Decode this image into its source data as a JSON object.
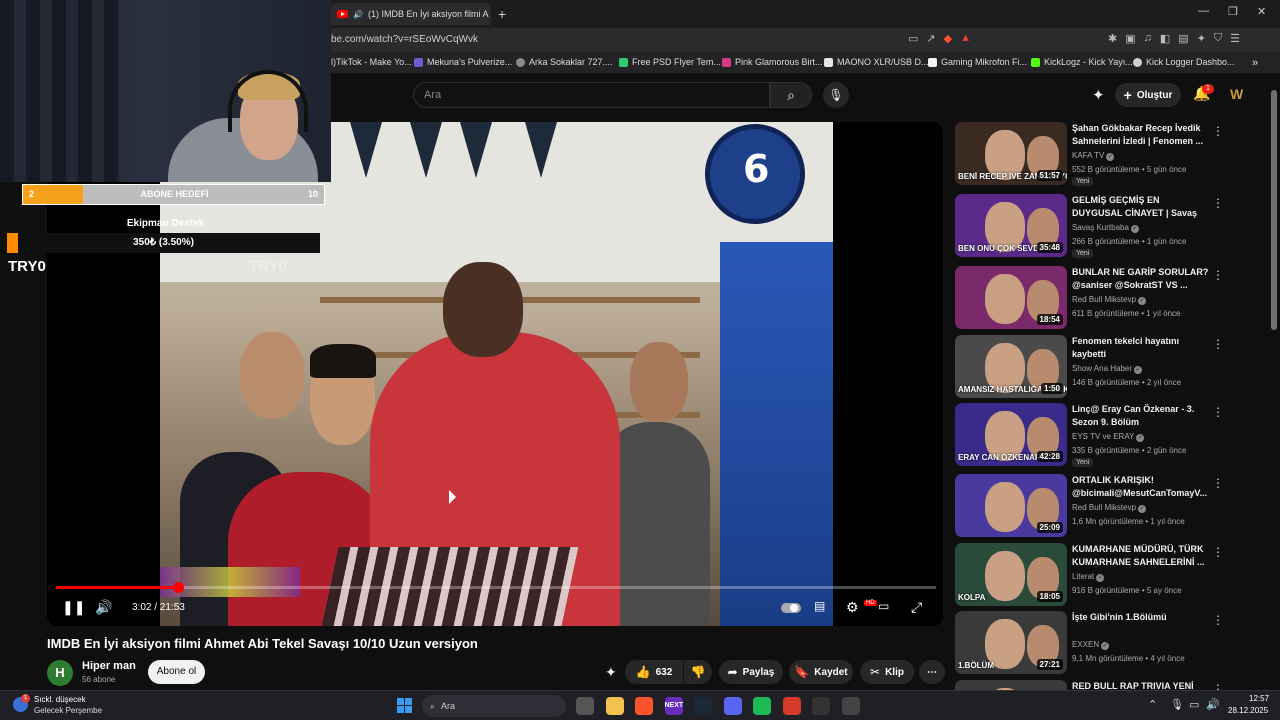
{
  "browser": {
    "tab_title": "(1) IMDB En İyi aksiyon filmi A",
    "tab_close": "✕",
    "new_tab": "+",
    "url": "be.com/watch?v=rSEoWvCqWvk",
    "window_controls": [
      "—",
      "❐",
      "✕"
    ],
    "bookmarks": [
      {
        "label": "l)TikTok - Make Yo...",
        "color": "#000000"
      },
      {
        "label": "Mekuna's Pulverize...",
        "color": "#6d5bd0"
      },
      {
        "label": "Arka Sokaklar 727....",
        "color": "#8a8a8a"
      },
      {
        "label": "Free PSD Flyer Tem...",
        "color": "#2ecc71"
      },
      {
        "label": "Pink Glamorous Birt...",
        "color": "#d83a8a"
      },
      {
        "label": "MAONO XLR/USB D...",
        "color": "#e6e6e6"
      },
      {
        "label": "Gaming Mikrofon Fi...",
        "color": "#f3f3f3"
      },
      {
        "label": "KickLogz - Kick Yayı...",
        "color": "#53fc18"
      },
      {
        "label": "Kick Logger Dashbo...",
        "color": "#cfcfcf"
      }
    ]
  },
  "header": {
    "search_placeholder": "Ara",
    "create_label": "Oluştur",
    "notification_count": "1"
  },
  "overlay": {
    "goal_current": "2",
    "goal_label": "ABONE HEDEFİ",
    "goal_target": "10",
    "goal_fraction": 0.2,
    "equipment_title": "Ekipman Destek",
    "equipment_amount": "350₺ (3.50%)",
    "equipment_fraction": 0.035,
    "streamer_name": "TRY0",
    "watermark": "TRY0"
  },
  "player": {
    "clock_numeral": "6",
    "time_display": "3:02 / 21:53",
    "progress_fraction": 0.1386,
    "hd_label": "HD"
  },
  "video": {
    "title": "IMDB En İyi aksiyon filmi Ahmet Abi Tekel Savaşı 10/10 Uzun versiyon",
    "channel_initial": "H",
    "channel_name": "Hiper man",
    "subscribers": "56 abone",
    "subscribe_label": "Abone ol",
    "like_count": "632",
    "share_label": "Paylaş",
    "save_label": "Kaydet",
    "clip_label": "Klip",
    "more_label": "⋯"
  },
  "recommendations": [
    {
      "title": "Şahan Gökbakar Recep İvedik Sahnelerini İzledi | Fenomen ...",
      "channel": "KAFA TV",
      "meta": "552 B görüntüleme • 5 gün önce",
      "duration": "51:57",
      "badge": "Yeni",
      "caption": "BENİ RECEP İVE ZANNEDİYORL",
      "bg": "#3a2a22"
    },
    {
      "title": "GELMİŞ GEÇMİŞ EN DUYGUSAL CİNAYET | Savaş Kurtbaba ile ...",
      "channel": "Savaş Kurtbaba",
      "meta": "266 B görüntüleme • 1 gün önce",
      "duration": "35:48",
      "badge": "Yeni",
      "caption": "BEN ONU ÇOK SEVDİ",
      "bg": "#5a2a8a"
    },
    {
      "title": "BUNLAR NE GARİP SORULAR? @saniser @SokratST VS ...",
      "channel": "Red Bull Mikstevp",
      "meta": "611 B görüntüleme • 1 yıl önce",
      "duration": "18:54",
      "badge": "",
      "caption": "",
      "bg": "#7a2a6a"
    },
    {
      "title": "Fenomen tekelci hayatını kaybetti",
      "channel": "Show Ana Haber",
      "meta": "146 B görüntüleme • 2 yıl önce",
      "duration": "1:50",
      "badge": "",
      "caption": "AMANSIZ HASTALIĞA YENİK",
      "bg": "#4a4a4a"
    },
    {
      "title": "Linç@ Eray Can Özkenar - 3. Sezon 9. Bölüm",
      "channel": "EYS TV ve ERAY",
      "meta": "335 B görüntüleme • 2 gün önce",
      "duration": "42:28",
      "badge": "Yeni",
      "caption": "ERAY CAN ÖZKENAR",
      "bg": "#3a2a8a"
    },
    {
      "title": "ORTALIK KARIŞIK! @bicimali@MesutCanTomayV...",
      "channel": "Red Bull Mikstevp",
      "meta": "1,6 Mn görüntüleme • 1 yıl önce",
      "duration": "25:09",
      "badge": "",
      "caption": "",
      "bg": "#4a3aa0"
    },
    {
      "title": "KUMARHANE MÜDÜRÜ, TÜRK KUMARHANE SAHNELERİNİ ...",
      "channel": "Literat",
      "meta": "916 B görüntüleme • 5 ay önce",
      "duration": "18:05",
      "badge": "",
      "caption": "KOLPA",
      "bg": "#2a4a3a"
    },
    {
      "title": "İşte Gibi'nin 1.Bölümü",
      "channel": "EXXEN",
      "meta": "9,1 Mn görüntüleme • 4 yıl önce",
      "duration": "27:21",
      "badge": "",
      "caption": "1.BÖLÜM",
      "bg": "#3a3a3a"
    },
    {
      "title": "RED BULL RAP TRIVIA YENİ",
      "channel": "",
      "meta": "",
      "duration": "",
      "badge": "",
      "caption": "",
      "bg": "#3a3a3a"
    }
  ],
  "taskbar": {
    "weather_line1": "Sıckl. düşecek",
    "weather_line2": "Gelecek Perşembe",
    "weather_badge": "1",
    "search_label": "Ara",
    "time": "12:57",
    "date": "28.12.2025",
    "apps": [
      {
        "name": "task-view",
        "label": "",
        "color": "#555555"
      },
      {
        "name": "file-explorer",
        "label": "",
        "color": "#f2c14e"
      },
      {
        "name": "brave",
        "label": "",
        "color": "#fb542b"
      },
      {
        "name": "kick-next",
        "label": "NEXT",
        "color": "#6a2bbf"
      },
      {
        "name": "steam",
        "label": "",
        "color": "#1b2838"
      },
      {
        "name": "discord",
        "label": "",
        "color": "#5865f2"
      },
      {
        "name": "spotify",
        "label": "",
        "color": "#1db954"
      },
      {
        "name": "app-red",
        "label": "",
        "color": "#d63a2a"
      },
      {
        "name": "app-ring",
        "label": "",
        "color": "#333333"
      },
      {
        "name": "settings",
        "label": "",
        "color": "#444444"
      }
    ]
  },
  "colors": {
    "accent_red": "#ff0000",
    "goal_orange": "#f5a11b",
    "background": "#0f0f0f"
  }
}
